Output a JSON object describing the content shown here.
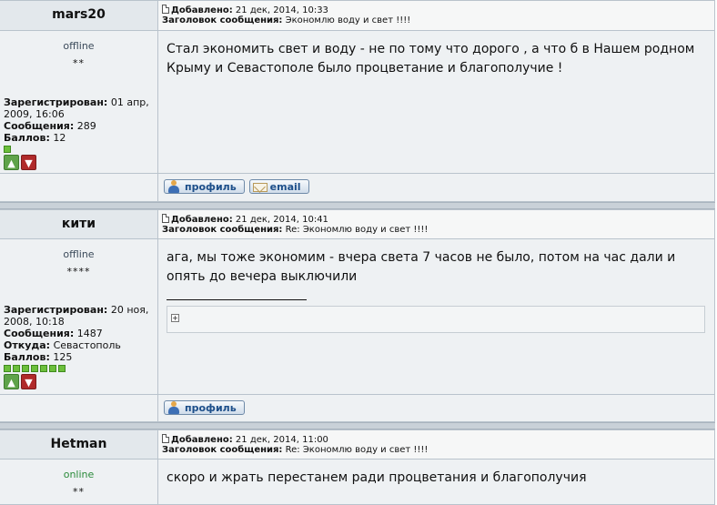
{
  "labels": {
    "added": "Добавлено:",
    "subject": "Заголовок сообщения:",
    "registered": "Зарегистрирован:",
    "messages": "Сообщения:",
    "points": "Баллов:",
    "from": "Откуда:"
  },
  "buttons": {
    "profile": "профиль",
    "email": "email"
  },
  "posts": [
    {
      "author": "mars20",
      "status": "offline",
      "stars": "**",
      "registered": "01 апр, 2009, 16:06",
      "messages": "289",
      "points": "12",
      "rank_squares": 1,
      "date": "21 дек, 2014, 10:33",
      "subject": "Экономлю воду и свет !!!!",
      "text": "Стал экономить свет и воду - не по тому что дорого , а что б в Нашем родном Крыму и Севастополе было процветание и благополучие !"
    },
    {
      "author": "кити",
      "status": "offline",
      "stars": "****",
      "registered": "20 ноя, 2008, 10:18",
      "messages": "1487",
      "from": "Севастополь",
      "points": "125",
      "rank_squares": 7,
      "date": "21 дек, 2014, 10:41",
      "subject": "Re: Экономлю воду и свет !!!!",
      "text": "ага, мы тоже экономим - вчера света 7 часов не было, потом на час дали и опять до вечера выключили"
    },
    {
      "author": "Hetman",
      "status": "online",
      "stars": "**",
      "date": "21 дек, 2014, 11:00",
      "subject": "Re: Экономлю воду и свет !!!!",
      "text": "скоро и жрать перестанем ради процветания и благополучия"
    }
  ],
  "colors": {
    "online": "#2a8a3a",
    "offline": "#3b4a5a",
    "vote_up": "#5fa34a",
    "vote_down": "#b02a2a"
  }
}
